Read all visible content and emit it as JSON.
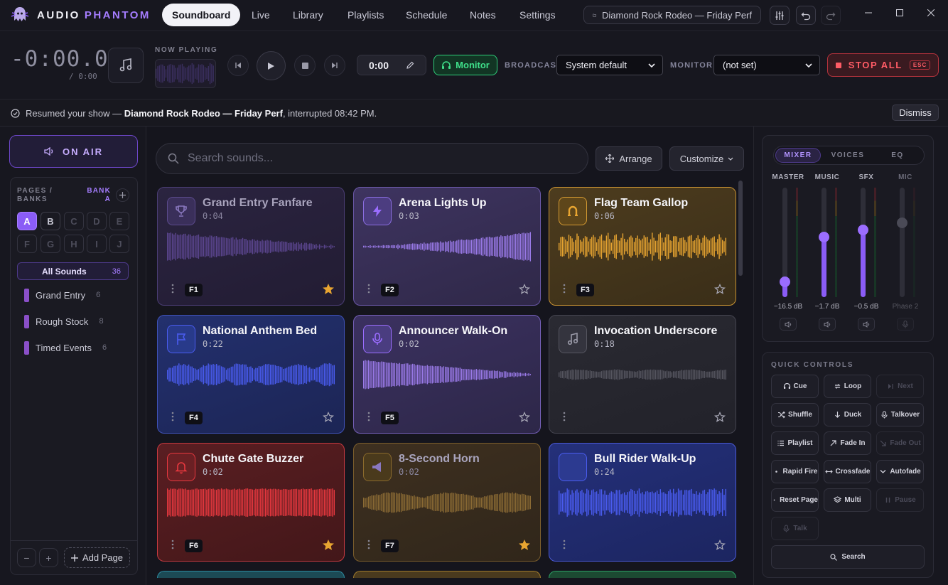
{
  "app": {
    "name_part1": "AUDIO",
    "name_part2": "PHANTOM",
    "logo_icon": "ghost-logo-icon"
  },
  "nav": {
    "tabs": [
      "Soundboard",
      "Live",
      "Library",
      "Playlists",
      "Schedule",
      "Notes",
      "Settings"
    ],
    "active": "Soundboard"
  },
  "show": {
    "title": "Diamond Rock Rodeo — Friday Perf",
    "icon": "folder-icon"
  },
  "transport": {
    "elapsed": "-0:00.0",
    "total": "/ 0:00",
    "now_playing_label": "NOW PLAYING",
    "position": "0:00",
    "monitor_label": "Monitor",
    "broadcast_label": "BROADCAST",
    "broadcast_value": "System default",
    "monitor_device_label": "MONITOR",
    "monitor_device_value": "(not set)",
    "stop_all_label": "STOP ALL",
    "stop_all_key": "ESC"
  },
  "banner": {
    "prefix": "Resumed your show — ",
    "show": "Diamond Rock Rodeo — Friday Perf",
    "suffix": ", interrupted 08:42 PM.",
    "dismiss_label": "Dismiss"
  },
  "sidebar": {
    "on_air_label": "ON AIR",
    "pages_label": "PAGES / BANKS",
    "bank_label": "BANK A",
    "banks": [
      "A",
      "B",
      "C",
      "D",
      "E",
      "F",
      "G",
      "H",
      "I",
      "J"
    ],
    "active_bank": "A",
    "all_sounds_label": "All Sounds",
    "all_sounds_count": "36",
    "pages": [
      {
        "name": "Grand Entry",
        "count": "6"
      },
      {
        "name": "Rough Stock",
        "count": "8"
      },
      {
        "name": "Timed Events",
        "count": "6"
      }
    ],
    "minus_label": "−",
    "plus_label": "+",
    "add_page_label": "Add Page"
  },
  "toolbar": {
    "search_placeholder": "Search sounds...",
    "arrange_label": "Arrange",
    "customize_label": "Customize"
  },
  "sounds": [
    {
      "name": "Grand Entry Fanfare",
      "duration": "0:04",
      "key": "F1",
      "starred": true,
      "icon": "trophy-icon",
      "color": "#8a5cf6"
    },
    {
      "name": "Arena Lights Up",
      "duration": "0:03",
      "key": "F2",
      "starred": false,
      "icon": "lightning-icon",
      "color": "#9b6dff"
    },
    {
      "name": "Flag Team Gallop",
      "duration": "0:06",
      "key": "F3",
      "starred": false,
      "icon": "horseshoe-icon",
      "color": "#e8a531"
    },
    {
      "name": "National Anthem Bed",
      "duration": "0:22",
      "key": "F4",
      "starred": false,
      "icon": "flag-icon",
      "color": "#4a5cf0"
    },
    {
      "name": "Announcer Walk-On",
      "duration": "0:02",
      "key": "F5",
      "starred": false,
      "icon": "microphone-icon",
      "color": "#9b6dff"
    },
    {
      "name": "Invocation Underscore",
      "duration": "0:18",
      "key": "",
      "starred": false,
      "icon": "music-note-icon",
      "color": "#8a8a98"
    },
    {
      "name": "Chute Gate Buzzer",
      "duration": "0:02",
      "key": "F6",
      "starred": true,
      "icon": "bell-icon",
      "color": "#e8383f"
    },
    {
      "name": "8-Second Horn",
      "duration": "0:02",
      "key": "F7",
      "starred": true,
      "icon": "horn-icon",
      "color": "#c08a2a"
    },
    {
      "name": "Bull Rider Walk-Up",
      "duration": "0:24",
      "key": "",
      "starred": false,
      "icon": "bull-horns-icon",
      "color": "#4a5cf0"
    }
  ],
  "mixer": {
    "tabs": [
      "MIXER",
      "VOICES",
      "EQ"
    ],
    "active_tab": "MIXER",
    "channels": [
      {
        "name": "MASTER",
        "db": "−16.5 dB",
        "level": 0.14,
        "enabled": true
      },
      {
        "name": "MUSIC",
        "db": "−1.7 dB",
        "level": 0.55,
        "enabled": true
      },
      {
        "name": "SFX",
        "db": "−0.5 dB",
        "level": 0.62,
        "enabled": true
      },
      {
        "name": "MIC",
        "db": "Phase 2",
        "level": 0.68,
        "enabled": false
      }
    ]
  },
  "quick_controls": {
    "label": "QUICK CONTROLS",
    "buttons": [
      {
        "label": "Cue",
        "icon": "headphones-icon",
        "enabled": true
      },
      {
        "label": "Loop",
        "icon": "loop-icon",
        "enabled": true
      },
      {
        "label": "Next",
        "icon": "skip-next-icon",
        "enabled": false
      },
      {
        "label": "Shuffle",
        "icon": "shuffle-icon",
        "enabled": true
      },
      {
        "label": "Duck",
        "icon": "arrow-down-icon",
        "enabled": true
      },
      {
        "label": "Talkover",
        "icon": "microphone-icon",
        "enabled": true
      },
      {
        "label": "Playlist",
        "icon": "list-icon",
        "enabled": true
      },
      {
        "label": "Fade In",
        "icon": "arrow-up-right-icon",
        "enabled": true
      },
      {
        "label": "Fade Out",
        "icon": "arrow-down-right-icon",
        "enabled": false
      },
      {
        "label": "Rapid Fire",
        "icon": "dot-icon",
        "enabled": true
      },
      {
        "label": "Crossfade",
        "icon": "crossfade-icon",
        "enabled": true
      },
      {
        "label": "Autofade",
        "icon": "chevron-down-icon",
        "enabled": true
      },
      {
        "label": "Reset Page",
        "icon": "dot-icon",
        "enabled": true
      },
      {
        "label": "Multi",
        "icon": "layers-icon",
        "enabled": true
      },
      {
        "label": "Pause",
        "icon": "pause-icon",
        "enabled": false
      },
      {
        "label": "Talk",
        "icon": "microphone-icon",
        "enabled": false
      }
    ],
    "search_label": "Search"
  }
}
